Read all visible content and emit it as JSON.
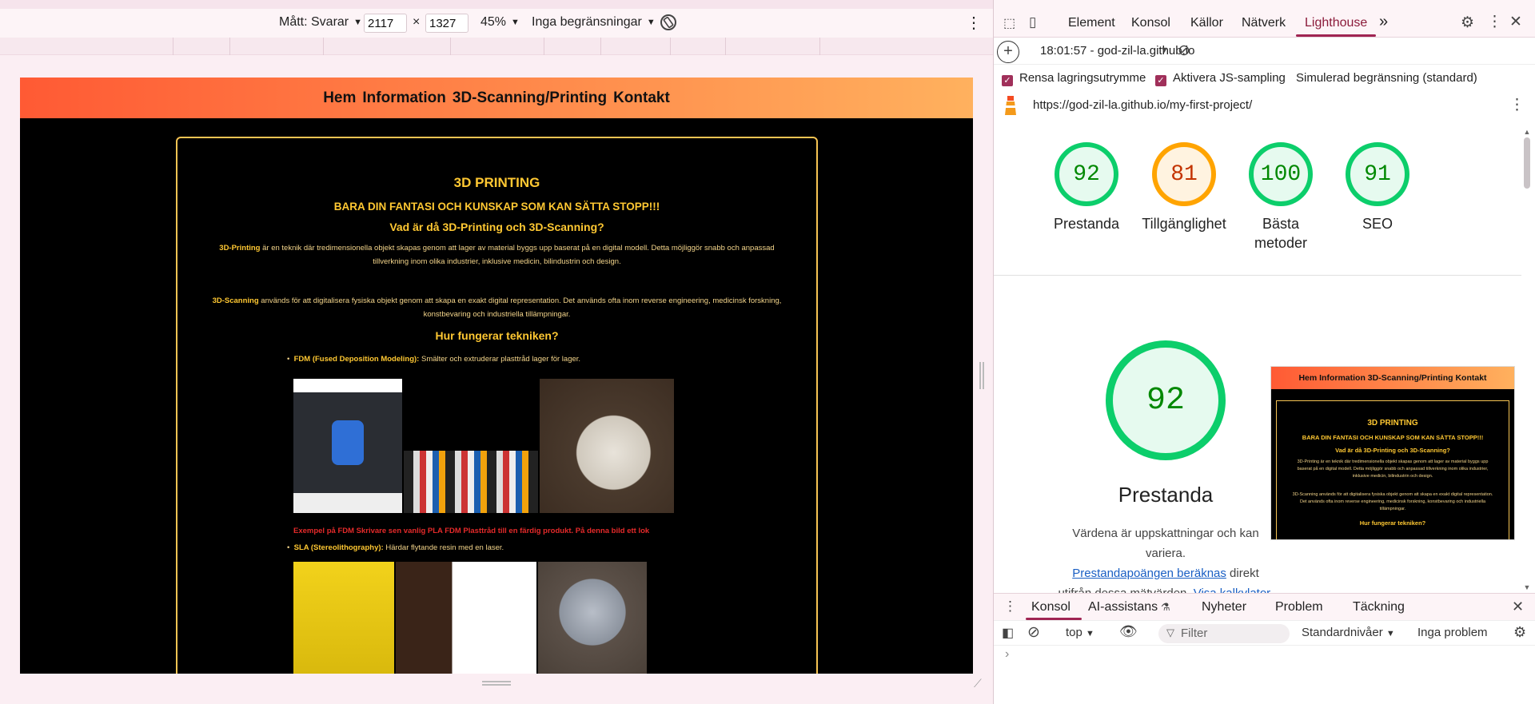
{
  "device_toolbar": {
    "dimensions_label": "Mått: Svarar",
    "width_value": "2117",
    "times": "×",
    "height_value": "1327",
    "zoom": "45%",
    "throttling": "Inga begränsningar"
  },
  "page": {
    "nav": [
      "Hem",
      "Information",
      "3D-Scanning/Printing",
      "Kontakt"
    ],
    "heading": "3D PRINTING",
    "subheading": "BARA DIN FANTASI OCH KUNSKAP SOM KAN SÄTTA STOPP!!!",
    "question": "Vad är då 3D-Printing och 3D-Scanning?",
    "printing_term": "3D-Printing",
    "printing_text": " är en teknik där tredimensionella objekt skapas genom att lager av material byggs upp baserat på en digital modell. Detta möjliggör snabb och anpassad tillverkning inom olika industrier, inklusive medicin, bilindustrin och design.",
    "scanning_term": "3D-Scanning",
    "scanning_text": " används för att digitalisera fysiska objekt genom att skapa en exakt digital representation. Det används ofta inom reverse engineering, medicinsk forskning, konstbevaring och industriella tillämpningar.",
    "how_heading": "Hur fungerar tekniken?",
    "fdm_term": "FDM (Fused Deposition Modeling):",
    "fdm_text": " Smälter och extruderar plasttråd lager för lager.",
    "fdm_example": "Exempel på FDM Skrivare sen vanlig PLA FDM Plasttråd till en färdig produkt. På denna bild ett lok",
    "sla_term": "SLA (Stereolithography):",
    "sla_text": " Härdar flytande resin med en laser."
  },
  "devtools": {
    "tabs": [
      "Element",
      "Konsol",
      "Källor",
      "Nätverk",
      "Lighthouse"
    ],
    "active_tab": "Lighthouse",
    "more": "»",
    "report_time": "18:01:57 - god-zil-la.github.io",
    "option_clear_storage": "Rensa lagringsutrymme",
    "option_js_sampling": "Aktivera JS-sampling",
    "option_throttling": "Simulerad begränsning (standard)",
    "url": "https://god-zil-la.github.io/my-first-project/",
    "scores": [
      {
        "value": "92",
        "label": "Prestanda",
        "tone": "green"
      },
      {
        "value": "81",
        "label": "Tillgänglighet",
        "tone": "orange"
      },
      {
        "value": "100",
        "label": "Bästa metoder",
        "tone": "green"
      },
      {
        "value": "91",
        "label": "SEO",
        "tone": "green"
      }
    ],
    "perf_score": "92",
    "perf_title": "Prestanda",
    "perf_desc_1": "Värdena är uppskattningar och kan variera.",
    "perf_link_1": "Prestandapoängen beräknas",
    "perf_desc_2": " direkt utifrån dessa mätvärden.",
    "perf_link_2": "Visa kalkylator.",
    "thumb_nav": "Hem  Information 3D-Scanning/Printing  Kontakt",
    "thumb_h1": "3D PRINTING",
    "thumb_h2": "BARA DIN FANTASI OCH KUNSKAP SOM KAN SÄTTA STOPP!!!",
    "thumb_q": "Vad är då 3D-Printing och 3D-Scanning?",
    "thumb_p1": "3D-Printing är en teknik där tredimensionella objekt skapas genom att lager av material byggs upp baserat på en digital modell. Detta möjliggör snabb och anpassad tillverkning inom olika industrier, inklusive medicin, bilindustrin och design.",
    "thumb_p2": "3D-Scanning används för att digitalisera fysiska objekt genom att skapa en exakt digital representation. Det används ofta inom reverse engineering, medicinsk forskning, konstbevaring och industriella tillämpningar.",
    "thumb_how": "Hur fungerar tekniken?"
  },
  "console": {
    "tabs": [
      "Konsol",
      "AI-assistans",
      "Nyheter",
      "Problem",
      "Täckning"
    ],
    "context": "top",
    "filter_placeholder": "Filter",
    "levels": "Standardnivåer",
    "issues": "Inga problem",
    "prompt": "›"
  }
}
